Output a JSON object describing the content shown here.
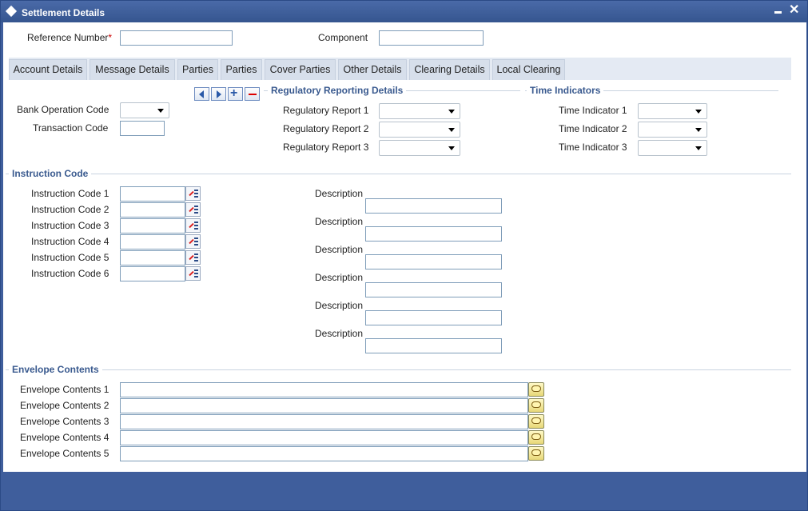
{
  "window": {
    "title": "Settlement Details"
  },
  "header": {
    "reference_label": "Reference Number",
    "required_mark": "*",
    "reference_value": "",
    "component_label": "Component",
    "component_value": ""
  },
  "tabs": [
    {
      "label": "Account Details"
    },
    {
      "label": "Message Details"
    },
    {
      "label": "Parties"
    },
    {
      "label": "Parties"
    },
    {
      "label": "Cover Parties"
    },
    {
      "label": "Other Details"
    },
    {
      "label": "Clearing Details"
    },
    {
      "label": "Local Clearing"
    }
  ],
  "left": {
    "bank_operation_code_label": "Bank Operation Code",
    "bank_operation_code_value": "",
    "transaction_code_label": "Transaction Code",
    "transaction_code_value": ""
  },
  "regulatory": {
    "section_title": "Regulatory Reporting Details",
    "items": [
      {
        "label": "Regulatory Report 1",
        "value": ""
      },
      {
        "label": "Regulatory Report 2",
        "value": ""
      },
      {
        "label": "Regulatory Report 3",
        "value": ""
      }
    ]
  },
  "time_indicators": {
    "section_title": "Time Indicators",
    "items": [
      {
        "label": "Time Indicator 1",
        "value": ""
      },
      {
        "label": "Time Indicator 2",
        "value": ""
      },
      {
        "label": "Time Indicator 3",
        "value": ""
      }
    ]
  },
  "instruction": {
    "section_title": "Instruction Code",
    "codes": [
      {
        "label": "Instruction Code 1",
        "value": ""
      },
      {
        "label": "Instruction Code 2",
        "value": ""
      },
      {
        "label": "Instruction Code 3",
        "value": ""
      },
      {
        "label": "Instruction Code 4",
        "value": ""
      },
      {
        "label": "Instruction Code 5",
        "value": ""
      },
      {
        "label": "Instruction Code 6",
        "value": ""
      }
    ],
    "descriptions": [
      {
        "label": "Description",
        "value": ""
      },
      {
        "label": "Description",
        "value": ""
      },
      {
        "label": "Description",
        "value": ""
      },
      {
        "label": "Description",
        "value": ""
      },
      {
        "label": "Description",
        "value": ""
      },
      {
        "label": "Description",
        "value": ""
      }
    ]
  },
  "envelope": {
    "section_title": "Envelope Contents",
    "items": [
      {
        "label": "Envelope Contents 1",
        "value": ""
      },
      {
        "label": "Envelope Contents 2",
        "value": ""
      },
      {
        "label": "Envelope Contents 3",
        "value": ""
      },
      {
        "label": "Envelope Contents 4",
        "value": ""
      },
      {
        "label": "Envelope Contents 5",
        "value": ""
      }
    ]
  },
  "icons": {
    "title": "diamond-icon",
    "minimize": "minimize-icon",
    "close": "close-icon",
    "nav_prev": "arrow-left-icon",
    "nav_next": "arrow-right-icon",
    "add": "plus-icon",
    "delete": "minus-icon",
    "lov": "list-of-values-icon",
    "edit": "speech-bubble-icon"
  },
  "colors": {
    "titlebar": "#3f5e9c",
    "section_title": "#3a5a8f",
    "required": "#cc0000"
  }
}
